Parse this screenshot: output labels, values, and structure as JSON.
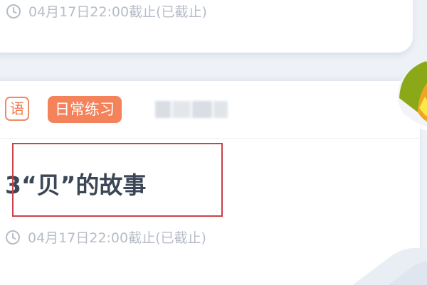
{
  "top_card": {
    "deadline": "04月17日22:00截止(已截止)"
  },
  "task_card": {
    "subject": "语",
    "type": "日常练习",
    "title": "3“贝”的故事",
    "deadline": "04月17日22:00截止(已截止)"
  },
  "colors": {
    "accent_orange": "#f4825a",
    "title_text": "#3b4656",
    "meta_text": "#b6bcc6",
    "highlight_border": "#cc4049"
  },
  "icons": {
    "deadline": "clock-icon"
  }
}
